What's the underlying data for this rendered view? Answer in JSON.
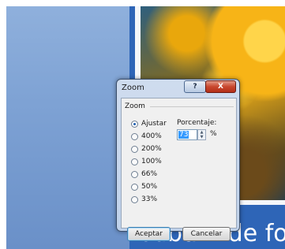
{
  "slide": {
    "title": "Álbum de fo"
  },
  "dialog": {
    "title": "Zoom",
    "help_label": "?",
    "close_label": "X",
    "group_label": "Zoom",
    "zoom_options": [
      {
        "label": "Ajustar",
        "selected": true
      },
      {
        "label": "400%",
        "selected": false
      },
      {
        "label": "200%",
        "selected": false
      },
      {
        "label": "100%",
        "selected": false
      },
      {
        "label": "66%",
        "selected": false
      },
      {
        "label": "50%",
        "selected": false
      },
      {
        "label": "33%",
        "selected": false
      }
    ],
    "percentage_label": "Porcentaje:",
    "percentage_value": "73",
    "percent_sign": "%",
    "ok_label": "Aceptar",
    "cancel_label": "Cancelar"
  }
}
